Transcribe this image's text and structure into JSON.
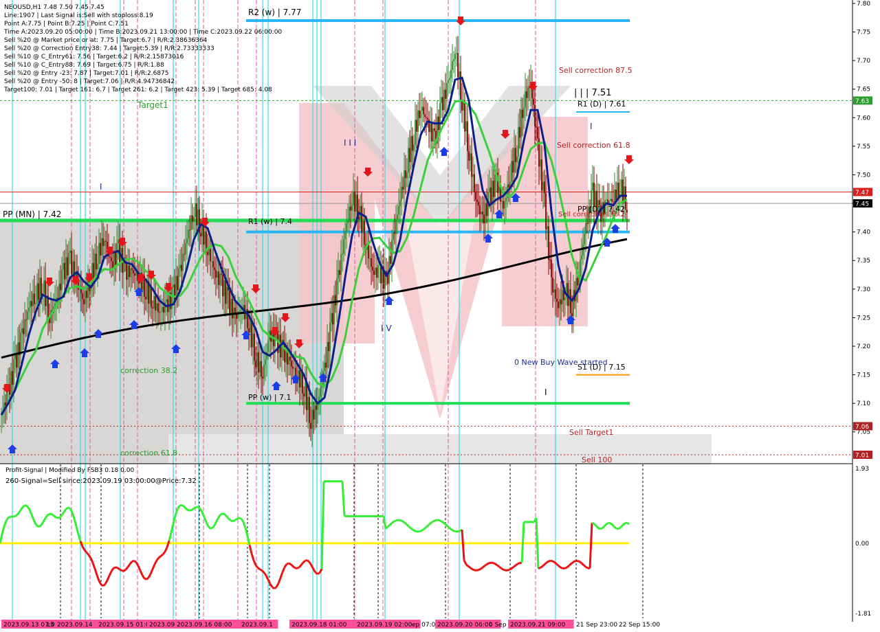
{
  "info": {
    "lines": [
      "NEOUSD,H1  7.48 7.50 7.45 7.45",
      "Line:1907 | Last Signal is:Sell with stoploss:8.19",
      "Point A:7.75 | Point B:7.25 | Point C:7.51",
      "Time A:2023.09.20 05:00:00 | Time B:2023.09.21 13:00:00 | Time C:2023.09.22 06:00:00",
      "Sell %20 @ Market price or at: 7.75 | Target:6.7 | R/R:2.38636364",
      "Sell %20 @ Correction Entry38: 7.44 | Target:5.39 | R/R:2.73333333",
      "Sell %10 @ C_Entry61: 7.56 | Target:6.2 | R/R:2.15873016",
      "Sell %10 @ C_Entry88: 7.69 | Target:6.75 | R/R:1.88",
      "Sell %20 @ Entry -23: 7.87 | Target:7.01 | R/R:2.6875",
      "Sell %20 @ Entry -50: 8 | Target:7.06 | R/R:4.94736842",
      "Target100: 7.01 | Target 161: 6.7 | Target 261: 6.2 | Target 423: 5.39 | Target 685: 4.08"
    ]
  },
  "levels": {
    "r2w": "R2 (w) | 7.77",
    "r1w": "R1 (w) | 7.4",
    "ppmn": "PP (MN) | 7.42",
    "ppw": "PP (w) | 7.1",
    "r1d": "R1 (D) | 7.61",
    "ppd": "PP (D) | 7.42",
    "s1d": "S1 (D) | 7.15",
    "wave_label": "| | | 7.51",
    "wave_i": "I",
    "wave_iii": "I I I",
    "wave_iv": "I V",
    "wave_small": "I"
  },
  "annotations": {
    "target1": "Target1",
    "sell_corr_875": "Sell correction 87.5",
    "sell_corr_618": "Sell correction 61.8",
    "sell_corr_382": "Sell correction 38.2",
    "correction_382": "correction 38.2",
    "correction_618": "correction 61.8",
    "new_buy_wave": "0 New Buy Wave started",
    "sell_target1": "Sell Target1",
    "sell_100": "Sell 100"
  },
  "price_axis": {
    "ticks": [
      "7.80",
      "7.75",
      "7.70",
      "7.65",
      "7.60",
      "7.55",
      "7.50",
      "7.45",
      "7.40",
      "7.35",
      "7.30",
      "7.25",
      "7.20",
      "7.15",
      "7.10",
      "7.05"
    ],
    "tags": [
      {
        "label": "7.63",
        "color": "#2e9c2e",
        "value": 7.63
      },
      {
        "label": "7.47",
        "color": "#d71f1f",
        "value": 7.47
      },
      {
        "label": "7.45",
        "color": "#000000",
        "value": 7.45
      },
      {
        "label": "7.06",
        "color": "#b22222",
        "value": 7.06
      },
      {
        "label": "7.01",
        "color": "#b22222",
        "value": 7.01
      }
    ]
  },
  "indicator": {
    "title": "Profit-Signal | Modified By FSB3 0.18 0.00",
    "signal": "260-Signal=Sell since:2023.09.19 03:00:00@Price:7.32",
    "axis": [
      "1.93",
      "0.00",
      "-1.81"
    ]
  },
  "time_axis": [
    {
      "label": "2023.09.13 07:00",
      "hl": true
    },
    {
      "label": "13",
      "hl": false
    },
    {
      "label": "2023.09.14",
      "hl": true
    },
    {
      "label": "2023.09.15 01:00",
      "hl": true
    },
    {
      "label": "2023.09",
      "hl": true
    },
    {
      "label": "2023.09.16 08:00",
      "hl": true
    },
    {
      "label": "2023.09.1",
      "hl": true
    },
    {
      "label": "2023.09.18 01:00",
      "hl": true
    },
    {
      "label": "2023.09.19 02:00",
      "hl": true
    },
    {
      "label": "ep 07:00",
      "hl": false
    },
    {
      "label": "2023.09.20 06:00",
      "hl": true
    },
    {
      "label": "0 Sep",
      "hl": false
    },
    {
      "label": "2023.09.21 09:00",
      "hl": true
    },
    {
      "label": "21 Sep 23:00",
      "hl": false
    },
    {
      "label": "22 Sep 15:00",
      "hl": false
    }
  ],
  "colors": {
    "bull": "#2e8b2e",
    "bear": "#8b0000",
    "sma_green": "#3ccf3c",
    "ema_blue": "#0b1f8a",
    "ma_black": "#000000",
    "pivot_blue": "#29b6f6",
    "pivot_green": "#22dd55",
    "vline_pink": "#e05aa0",
    "vline_cyan": "#38d9e6",
    "signal_green": "#33ee33",
    "signal_red": "#ee1111",
    "zero_yellow": "#ffee00"
  },
  "chart_data": {
    "type": "candlestick",
    "symbol": "NEOUSD",
    "timeframe": "H1",
    "ylim": [
      7.01,
      7.8
    ],
    "last": {
      "open": 7.48,
      "high": 7.5,
      "low": 7.45,
      "close": 7.45
    },
    "key_levels": {
      "R2_w": 7.77,
      "R1_D": 7.61,
      "PP_MN": 7.42,
      "R1_w": 7.4,
      "S1_D": 7.15,
      "PP_w": 7.1
    },
    "candles_approx": [
      {
        "x": 0,
        "c": 7.08
      },
      {
        "x": 10,
        "c": 7.12
      },
      {
        "x": 20,
        "c": 7.17
      },
      {
        "x": 30,
        "c": 7.22
      },
      {
        "x": 40,
        "c": 7.27
      },
      {
        "x": 50,
        "c": 7.29
      },
      {
        "x": 60,
        "c": 7.31
      },
      {
        "x": 70,
        "c": 7.25
      },
      {
        "x": 80,
        "c": 7.28
      },
      {
        "x": 90,
        "c": 7.33
      },
      {
        "x": 100,
        "c": 7.35
      },
      {
        "x": 110,
        "c": 7.31
      },
      {
        "x": 120,
        "c": 7.28
      },
      {
        "x": 130,
        "c": 7.32
      },
      {
        "x": 140,
        "c": 7.36
      },
      {
        "x": 150,
        "c": 7.39
      },
      {
        "x": 160,
        "c": 7.34
      },
      {
        "x": 170,
        "c": 7.37
      },
      {
        "x": 180,
        "c": 7.33
      },
      {
        "x": 190,
        "c": 7.33
      },
      {
        "x": 200,
        "c": 7.32
      },
      {
        "x": 210,
        "c": 7.3
      },
      {
        "x": 220,
        "c": 7.28
      },
      {
        "x": 230,
        "c": 7.26
      },
      {
        "x": 240,
        "c": 7.27
      },
      {
        "x": 250,
        "c": 7.29
      },
      {
        "x": 260,
        "c": 7.33
      },
      {
        "x": 270,
        "c": 7.39
      },
      {
        "x": 280,
        "c": 7.44
      },
      {
        "x": 290,
        "c": 7.41
      },
      {
        "x": 300,
        "c": 7.37
      },
      {
        "x": 310,
        "c": 7.33
      },
      {
        "x": 320,
        "c": 7.31
      },
      {
        "x": 330,
        "c": 7.28
      },
      {
        "x": 340,
        "c": 7.25
      },
      {
        "x": 350,
        "c": 7.27
      },
      {
        "x": 360,
        "c": 7.24
      },
      {
        "x": 370,
        "c": 7.18
      },
      {
        "x": 380,
        "c": 7.15
      },
      {
        "x": 390,
        "c": 7.22
      },
      {
        "x": 400,
        "c": 7.21
      },
      {
        "x": 410,
        "c": 7.19
      },
      {
        "x": 420,
        "c": 7.17
      },
      {
        "x": 430,
        "c": 7.15
      },
      {
        "x": 440,
        "c": 7.13
      },
      {
        "x": 450,
        "c": 7.07
      },
      {
        "x": 460,
        "c": 7.1
      },
      {
        "x": 470,
        "c": 7.16
      },
      {
        "x": 480,
        "c": 7.24
      },
      {
        "x": 490,
        "c": 7.32
      },
      {
        "x": 500,
        "c": 7.4
      },
      {
        "x": 510,
        "c": 7.46
      },
      {
        "x": 520,
        "c": 7.44
      },
      {
        "x": 530,
        "c": 7.38
      },
      {
        "x": 540,
        "c": 7.33
      },
      {
        "x": 550,
        "c": 7.33
      },
      {
        "x": 560,
        "c": 7.31
      },
      {
        "x": 570,
        "c": 7.39
      },
      {
        "x": 580,
        "c": 7.46
      },
      {
        "x": 590,
        "c": 7.52
      },
      {
        "x": 600,
        "c": 7.57
      },
      {
        "x": 610,
        "c": 7.62
      },
      {
        "x": 620,
        "c": 7.59
      },
      {
        "x": 630,
        "c": 7.56
      },
      {
        "x": 640,
        "c": 7.62
      },
      {
        "x": 650,
        "c": 7.66
      },
      {
        "x": 660,
        "c": 7.72
      },
      {
        "x": 670,
        "c": 7.63
      },
      {
        "x": 680,
        "c": 7.54
      },
      {
        "x": 690,
        "c": 7.46
      },
      {
        "x": 700,
        "c": 7.42
      },
      {
        "x": 710,
        "c": 7.46
      },
      {
        "x": 720,
        "c": 7.49
      },
      {
        "x": 730,
        "c": 7.44
      },
      {
        "x": 740,
        "c": 7.5
      },
      {
        "x": 750,
        "c": 7.55
      },
      {
        "x": 760,
        "c": 7.63
      },
      {
        "x": 770,
        "c": 7.66
      },
      {
        "x": 780,
        "c": 7.55
      },
      {
        "x": 790,
        "c": 7.45
      },
      {
        "x": 800,
        "c": 7.31
      },
      {
        "x": 810,
        "c": 7.27
      },
      {
        "x": 820,
        "c": 7.3
      },
      {
        "x": 830,
        "c": 7.27
      },
      {
        "x": 840,
        "c": 7.33
      },
      {
        "x": 850,
        "c": 7.41
      },
      {
        "x": 860,
        "c": 7.47
      },
      {
        "x": 870,
        "c": 7.43
      },
      {
        "x": 880,
        "c": 7.45
      },
      {
        "x": 890,
        "c": 7.46
      },
      {
        "x": 900,
        "c": 7.48
      },
      {
        "x": 910,
        "c": 7.45
      }
    ],
    "indicator_range": [
      -1.81,
      1.93
    ]
  }
}
